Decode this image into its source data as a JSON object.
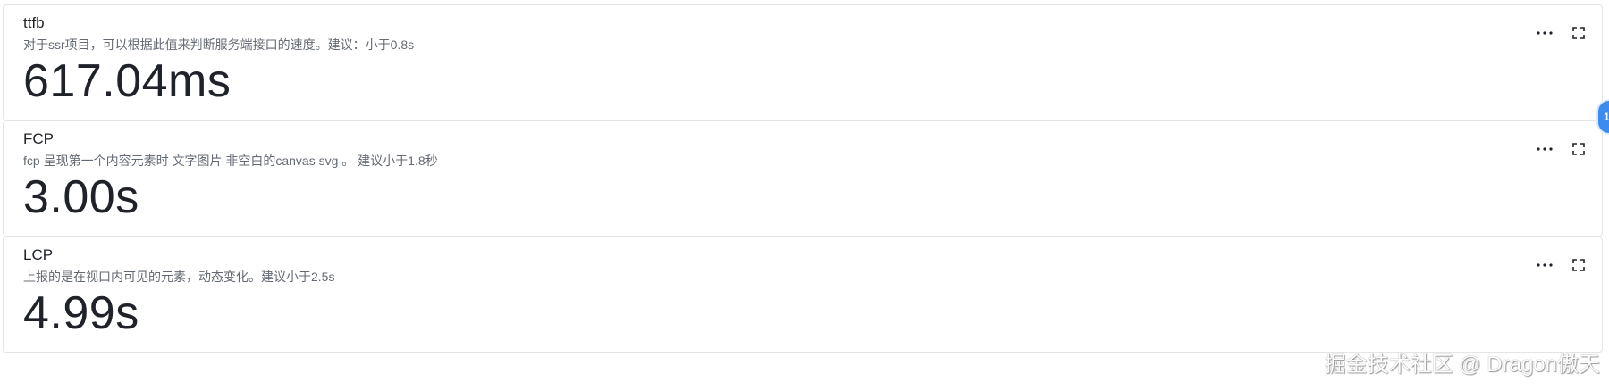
{
  "cards": [
    {
      "title": "ttfb",
      "description": "对于ssr项目，可以根据此值来判断服务端接口的速度。建议：小于0.8s",
      "value": "617.04ms"
    },
    {
      "title": "FCP",
      "description": "fcp 呈现第一个内容元素时 文字图片 非空白的canvas svg 。 建议小于1.8秒",
      "value": "3.00s"
    },
    {
      "title": "LCP",
      "description": "上报的是在视口内可见的元素，动态变化。建议小于2.5s",
      "value": "4.99s"
    }
  ],
  "icons": {
    "more": "more-horizontal-icon",
    "fullscreen": "fullscreen-icon"
  },
  "side_badge": {
    "label": "1",
    "color": "#3c8cf0"
  },
  "watermark": "掘金技术社区 @ Dragon傲天"
}
